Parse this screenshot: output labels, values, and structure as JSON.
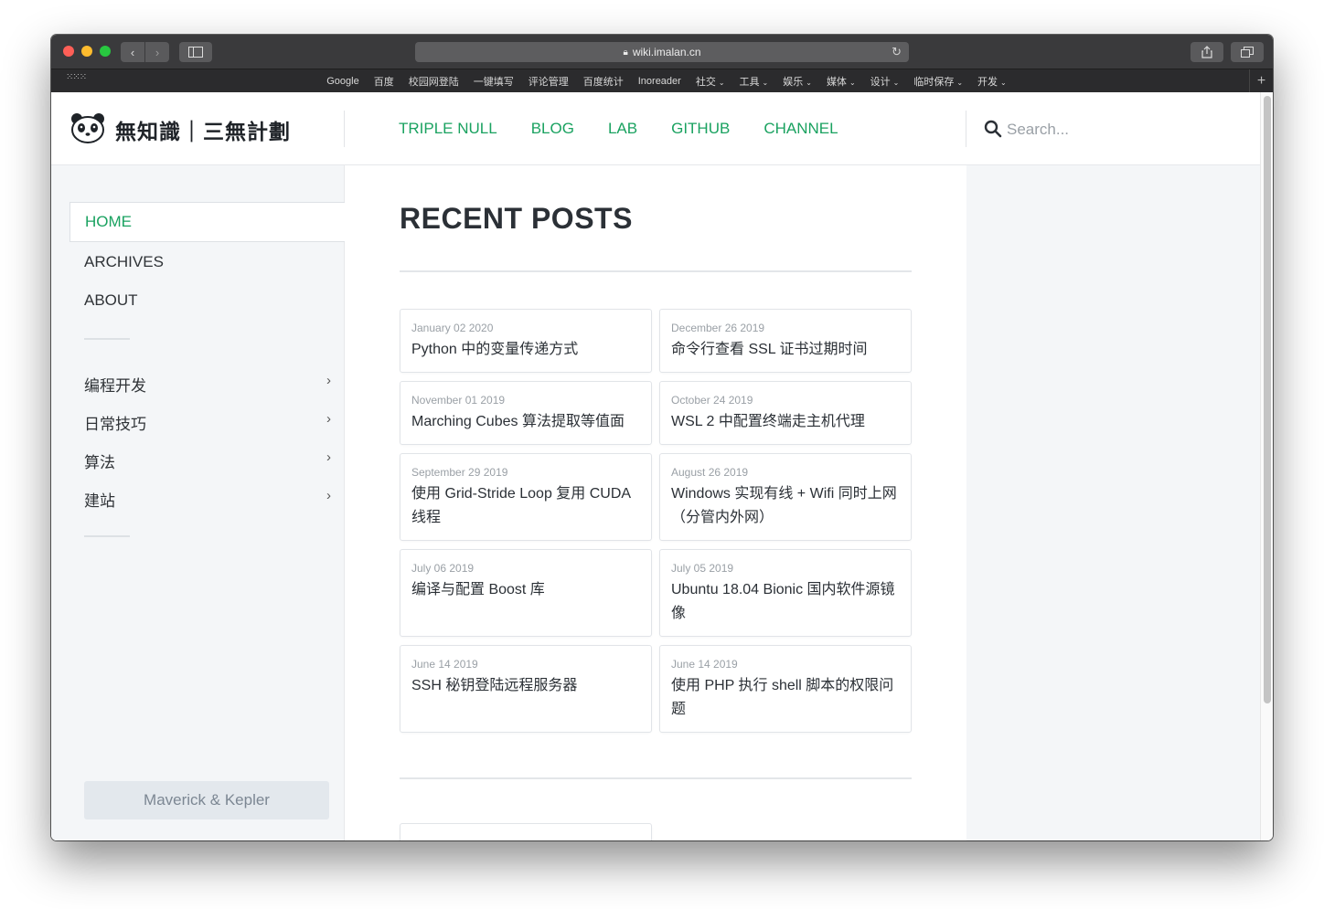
{
  "browser": {
    "url": "wiki.imalan.cn",
    "bookmarks": [
      {
        "label": "Google",
        "dropdown": false
      },
      {
        "label": "百度",
        "dropdown": false
      },
      {
        "label": "校园网登陆",
        "dropdown": false
      },
      {
        "label": "一键填写",
        "dropdown": false
      },
      {
        "label": "评论管理",
        "dropdown": false
      },
      {
        "label": "百度统计",
        "dropdown": false
      },
      {
        "label": "Inoreader",
        "dropdown": false
      },
      {
        "label": "社交",
        "dropdown": true
      },
      {
        "label": "工具",
        "dropdown": true
      },
      {
        "label": "娱乐",
        "dropdown": true
      },
      {
        "label": "媒体",
        "dropdown": true
      },
      {
        "label": "设计",
        "dropdown": true
      },
      {
        "label": "临时保存",
        "dropdown": true
      },
      {
        "label": "开发",
        "dropdown": true
      }
    ]
  },
  "header": {
    "site_title": "無知識｜三無計劃",
    "nav": [
      "TRIPLE NULL",
      "BLOG",
      "LAB",
      "GITHUB",
      "CHANNEL"
    ],
    "search_placeholder": "Search..."
  },
  "sidebar": {
    "items": [
      {
        "label": "HOME",
        "active": true
      },
      {
        "label": "ARCHIVES",
        "active": false
      },
      {
        "label": "ABOUT",
        "active": false
      }
    ],
    "categories": [
      "编程开发",
      "日常技巧",
      "算法",
      "建站"
    ],
    "footer_button": "Maverick & Kepler"
  },
  "main": {
    "title": "RECENT POSTS",
    "posts": [
      {
        "date": "January 02 2020",
        "title": "Python 中的变量传递方式"
      },
      {
        "date": "December 26 2019",
        "title": "命令行查看 SSL 证书过期时间"
      },
      {
        "date": "November 01 2019",
        "title": "Marching Cubes 算法提取等值面"
      },
      {
        "date": "October 24 2019",
        "title": "WSL 2 中配置终端走主机代理"
      },
      {
        "date": "September 29 2019",
        "title": "使用 Grid-Stride Loop 复用 CUDA 线程"
      },
      {
        "date": "August 26 2019",
        "title": "Windows 实现有线 + Wifi 同时上网（分管内外网）"
      },
      {
        "date": "July 06 2019",
        "title": "编译与配置 Boost 库"
      },
      {
        "date": "July 05 2019",
        "title": "Ubuntu 18.04 Bionic 国内软件源镜像"
      },
      {
        "date": "June 14 2019",
        "title": "SSH 秘钥登陆远程服务器"
      },
      {
        "date": "June 14 2019",
        "title": "使用 PHP 执行 shell 脚本的权限问题"
      }
    ]
  },
  "colors": {
    "accent": "#1aa260",
    "page_bg": "#f4f6f8",
    "titlebar": "#3a3a3c"
  }
}
